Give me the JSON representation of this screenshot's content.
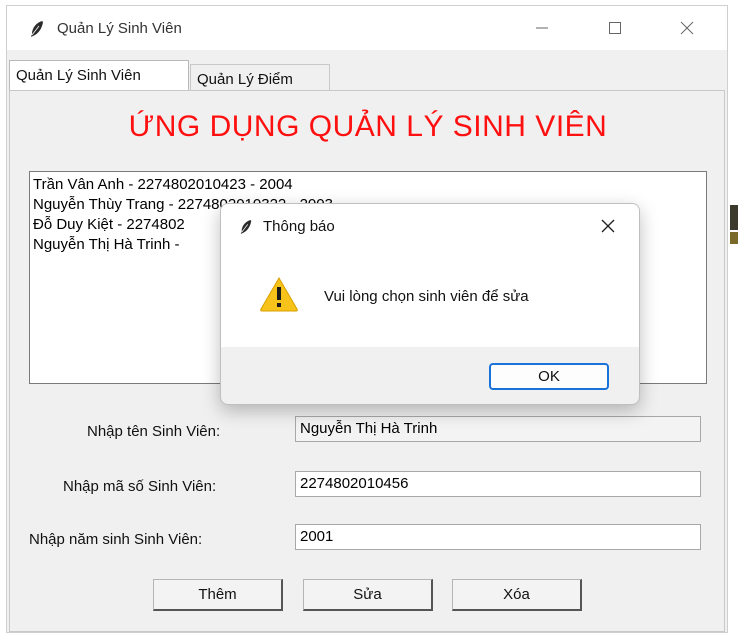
{
  "window": {
    "title": "Quản Lý Sinh Viên",
    "icon": "feather-icon"
  },
  "tabs": [
    {
      "label": "Quản Lý Sinh Viên",
      "active": true
    },
    {
      "label": "Quản Lý Điểm",
      "active": false
    }
  ],
  "heading": "ỨNG DỤNG QUẢN LÝ SINH VIÊN",
  "students": [
    "Trần Vân Anh - 2274802010423 - 2004",
    "Nguyễn Thùy Trang - 2274802010322 - 2003",
    "Đỗ Duy Kiệt  - 2274802",
    "Nguyễn Thị Hà Trinh -"
  ],
  "form": {
    "name_label": "Nhập tên Sinh Viên:",
    "name_value": "Nguyễn Thị Hà Trinh",
    "id_label": "Nhập mã số Sinh Viên:",
    "id_value": "2274802010456",
    "year_label": "Nhập năm sinh Sinh Viên:",
    "year_value": "2001"
  },
  "buttons": {
    "add": "Thêm",
    "edit": "Sửa",
    "delete": "Xóa"
  },
  "dialog": {
    "title": "Thông báo",
    "message": "Vui lòng chọn sinh viên để sửa",
    "ok": "OK",
    "icon": "warning-icon"
  },
  "colors": {
    "heading": "#ff1010",
    "ok_focus": "#1a73d9",
    "warning": "#f7c21a"
  }
}
